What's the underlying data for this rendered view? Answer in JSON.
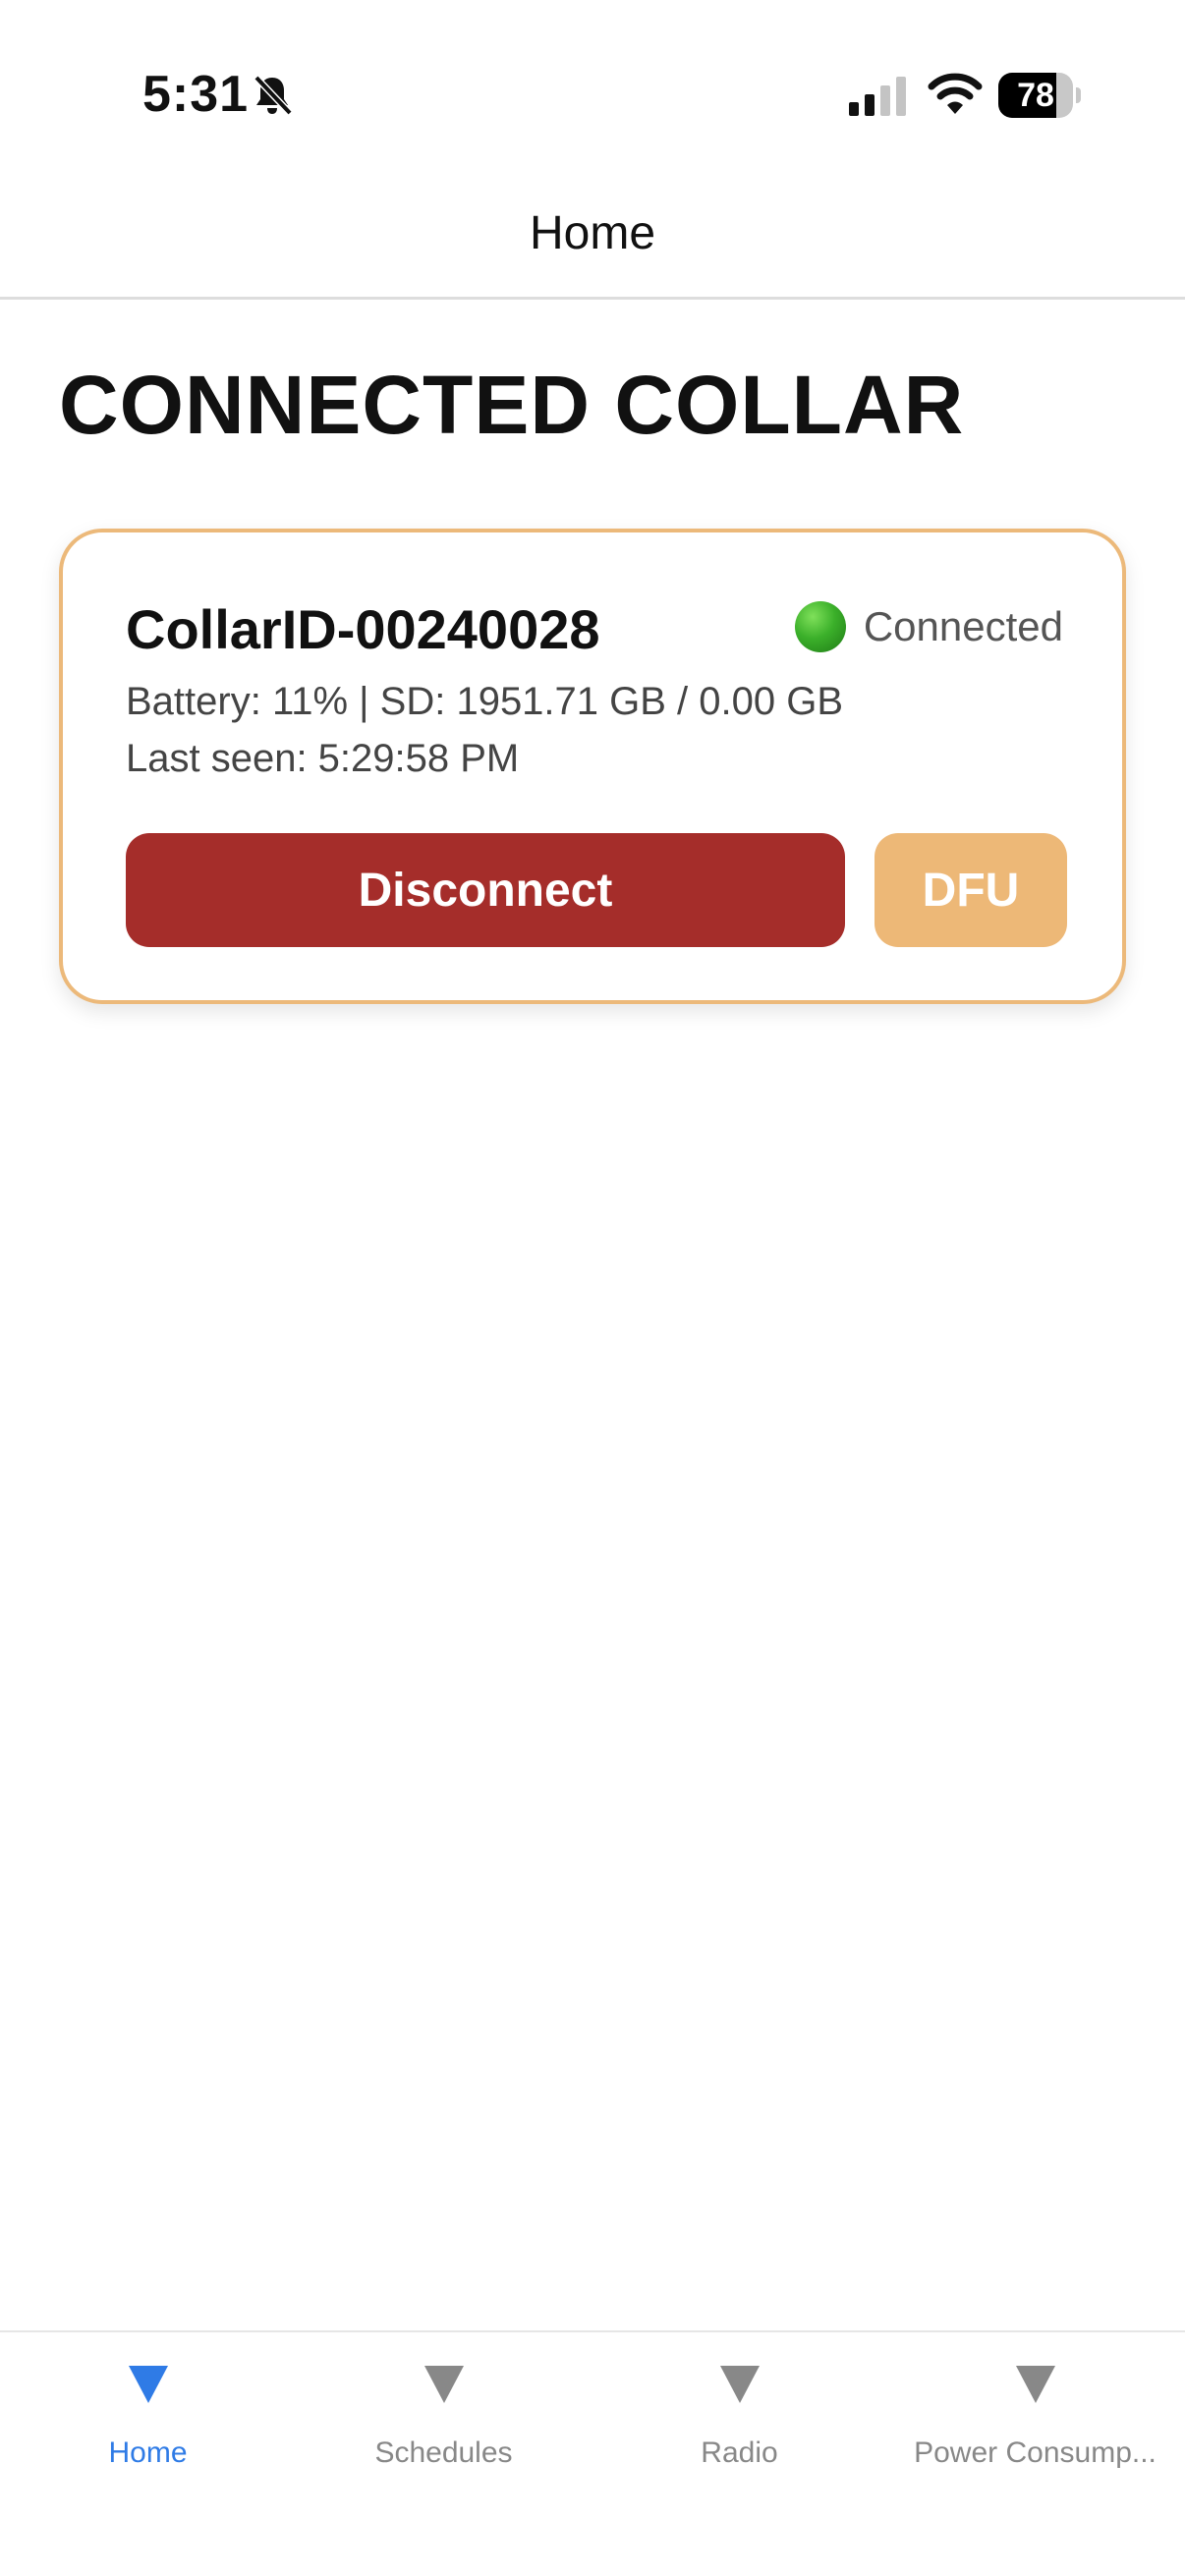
{
  "status_bar": {
    "time": "5:31",
    "battery_level": "78",
    "battery_fraction": 0.78,
    "icons": [
      "bell-slash-icon",
      "cellular-signal-icon",
      "wifi-icon",
      "battery-icon"
    ]
  },
  "nav": {
    "title": "Home"
  },
  "main": {
    "section_title": "CONNECTED COLLAR",
    "collar": {
      "id": "CollarID-00240028",
      "status": "Connected",
      "status_color": "#3bb02a",
      "battery_line": "Battery: 11% | SD: 1951.71 GB / 0.00 GB",
      "last_seen_line": "Last seen: 5:29:58 PM",
      "disconnect_label": "Disconnect",
      "dfu_label": "DFU"
    }
  },
  "tabs": [
    {
      "label": "Home",
      "active": true,
      "icon": "triangle-down-icon"
    },
    {
      "label": "Schedules",
      "active": false,
      "icon": "triangle-down-icon"
    },
    {
      "label": "Radio",
      "active": false,
      "icon": "triangle-down-icon"
    },
    {
      "label": "Power Consump...",
      "active": false,
      "icon": "triangle-down-icon"
    }
  ],
  "colors": {
    "accent": "#2f7be6",
    "card_border": "#ecb97a",
    "disconnect": "#a52d2a",
    "dfu": "#edb877",
    "inactive_tab": "#888888"
  }
}
